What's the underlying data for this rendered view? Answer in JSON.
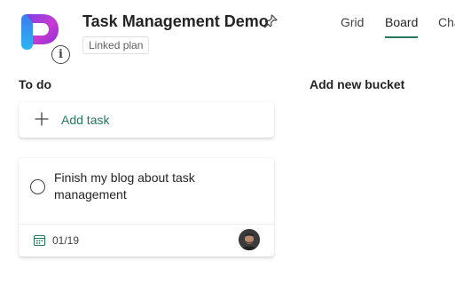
{
  "header": {
    "title": "Task Management Demo",
    "badge": "Linked plan",
    "icons": {
      "logo": "planner-logo-icon",
      "info": "info-icon",
      "pin": "pin-icon"
    }
  },
  "tabs": [
    {
      "label": "Grid",
      "selected": false
    },
    {
      "label": "Board",
      "selected": true
    },
    {
      "label": "Cha",
      "selected": false
    }
  ],
  "board": {
    "buckets": [
      {
        "name": "To do",
        "add_task_label": "Add task",
        "tasks": [
          {
            "title": "Finish my blog about task management",
            "due": "01/19",
            "completed": false,
            "assignee_avatar": "user-avatar"
          }
        ]
      }
    ],
    "add_bucket_label": "Add new bucket"
  },
  "colors": {
    "accent": "#257a5c",
    "text": "#242424",
    "logo_gradient": [
      "#4f2ed8",
      "#c93bd1",
      "#2bb6f2"
    ]
  }
}
